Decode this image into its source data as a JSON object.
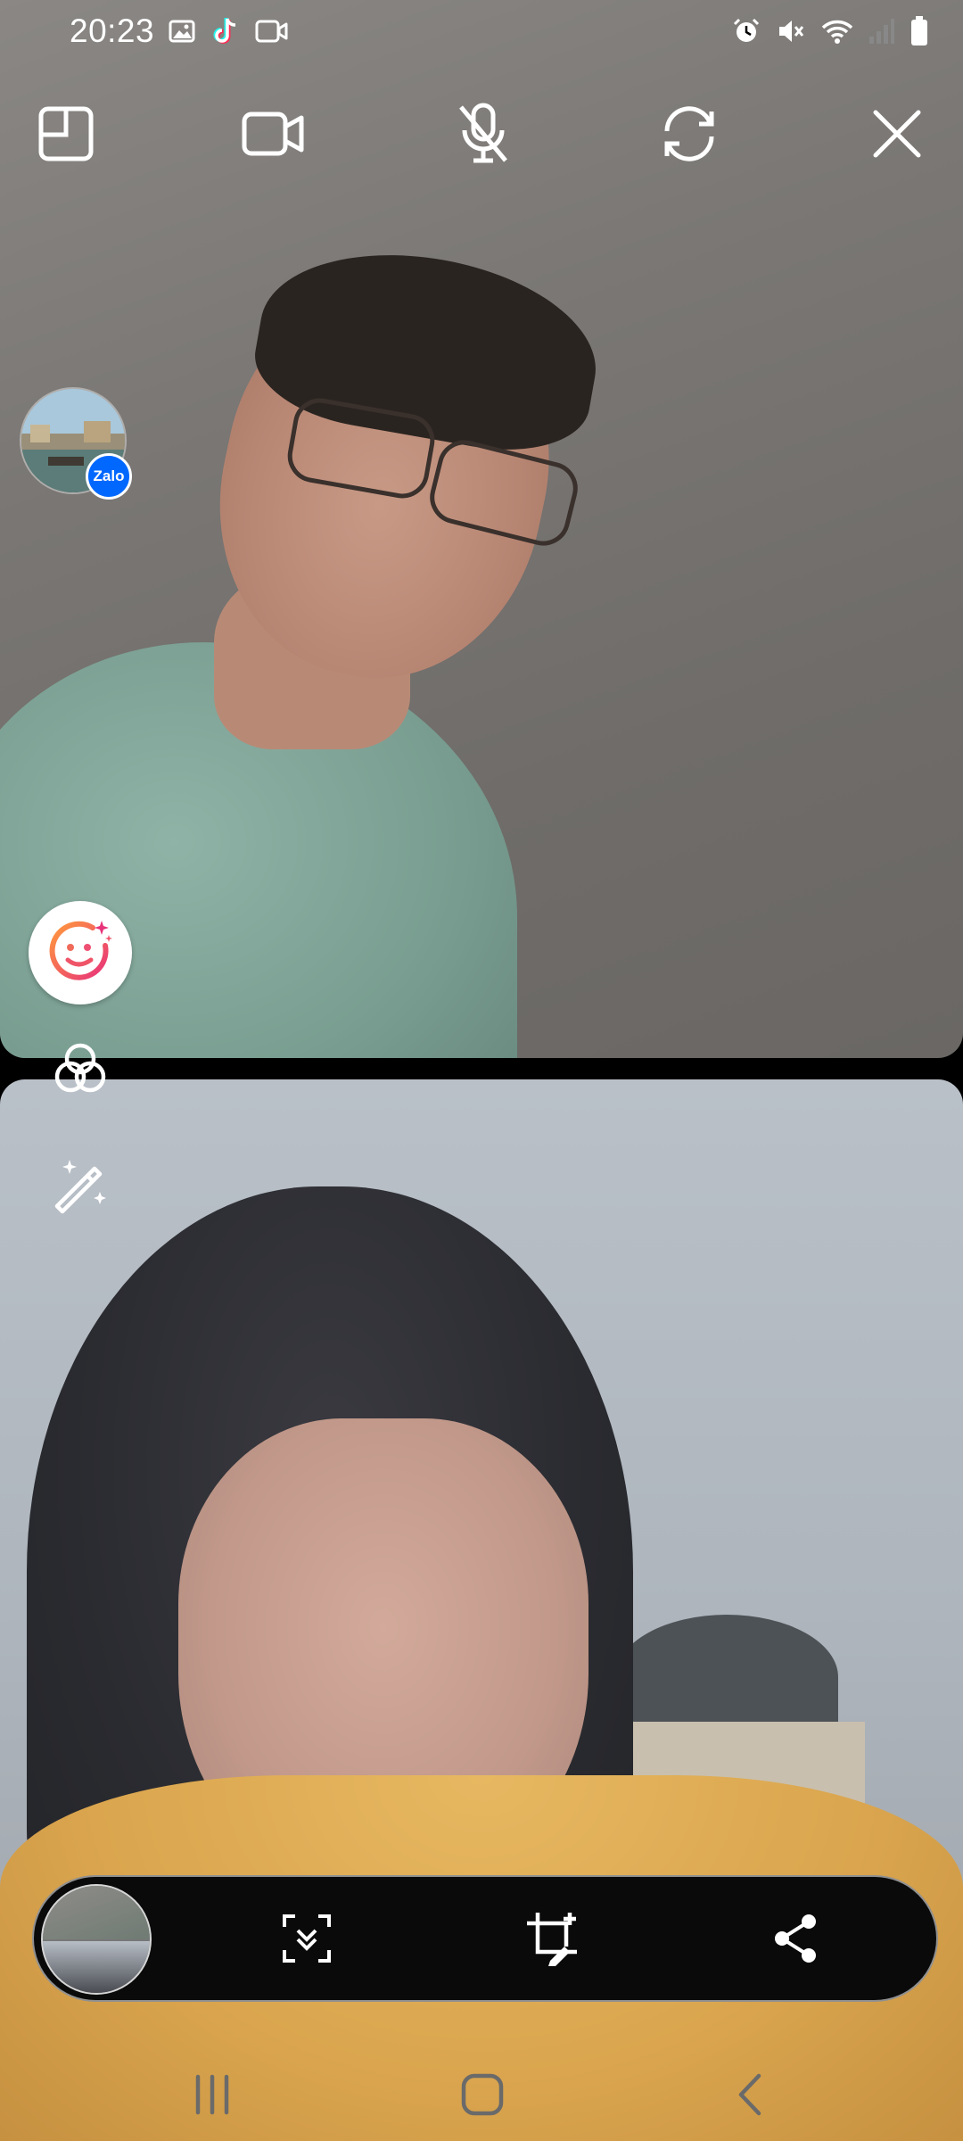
{
  "status_bar": {
    "time": "20:23",
    "left_icons": [
      "gallery-icon",
      "tiktok-icon",
      "screen-record-icon"
    ],
    "right_icons": [
      "alarm-icon",
      "mute-icon",
      "wifi-icon",
      "signal-icon",
      "battery-icon"
    ]
  },
  "call_controls": {
    "buttons": [
      "layout-icon",
      "video-camera-icon",
      "mic-off-icon",
      "switch-camera-icon",
      "close-icon"
    ]
  },
  "caller": {
    "badge_label": "Zalo",
    "badge_color": "#0068ff"
  },
  "effects": {
    "buttons": [
      "beauty-face-icon",
      "filter-icon",
      "magic-wand-icon"
    ],
    "beauty_accent": "#f0566f"
  },
  "screenshot_toolbar": {
    "buttons": [
      "scroll-capture-icon",
      "crop-edit-icon",
      "share-icon"
    ]
  },
  "nav_bar": {
    "buttons": [
      "recent-apps-icon",
      "home-icon",
      "back-icon"
    ]
  }
}
